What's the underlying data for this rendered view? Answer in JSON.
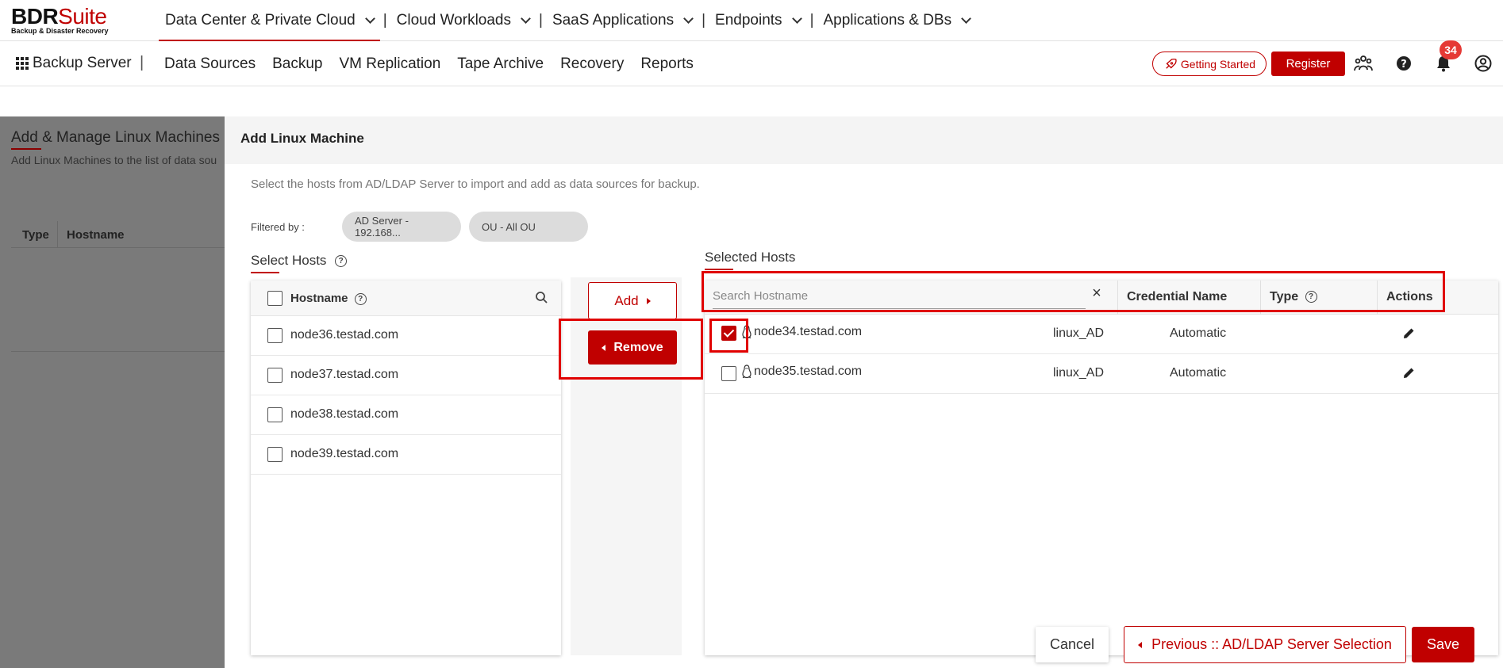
{
  "brand": {
    "name_bold": "BDR",
    "name_light": "Suite",
    "tagline": "Backup & Disaster Recovery"
  },
  "topnav": {
    "items": [
      {
        "label": "Data Center & Private Cloud"
      },
      {
        "label": "Cloud Workloads"
      },
      {
        "label": "SaaS Applications"
      },
      {
        "label": "Endpoints"
      },
      {
        "label": "Applications & DBs"
      }
    ],
    "separator": "|"
  },
  "subnav": {
    "app_name": "Backup Server",
    "separator": "|",
    "items": [
      "Data Sources",
      "Backup",
      "VM Replication",
      "Tape Archive",
      "Recovery",
      "Reports"
    ],
    "getting_started": "Getting Started",
    "register": "Register",
    "notification_count": "34"
  },
  "background_page": {
    "title": "Add & Manage Linux Machines (File",
    "subtitle": "Add Linux Machines to the list of data sou",
    "columns": [
      "Type",
      "Hostname"
    ]
  },
  "modal": {
    "title": "Add Linux Machine",
    "description": "Select the hosts from AD/LDAP Server to import and add as data sources for backup.",
    "filtered_by_label": "Filtered by :",
    "filters": [
      "AD Server - 192.168...",
      "OU - All OU"
    ],
    "select_hosts": {
      "label": "Select Hosts",
      "column": "Hostname",
      "rows": [
        "node36.testad.com",
        "node37.testad.com",
        "node38.testad.com",
        "node39.testad.com"
      ]
    },
    "add_label": "Add",
    "remove_label": "Remove",
    "selected_hosts": {
      "label": "Selected Hosts",
      "search_placeholder": "Search Hostname",
      "columns": {
        "credential": "Credential Name",
        "type": "Type",
        "actions": "Actions"
      },
      "rows": [
        {
          "hostname": "node34.testad.com",
          "credential": "linux_AD",
          "type": "Automatic",
          "checked": true
        },
        {
          "hostname": "node35.testad.com",
          "credential": "linux_AD",
          "type": "Automatic",
          "checked": false
        }
      ]
    },
    "footer": {
      "cancel": "Cancel",
      "previous": "Previous :: AD/LDAP Server Selection",
      "save": "Save"
    }
  },
  "colors": {
    "accent": "#c00000",
    "highlight": "#e00000",
    "overlay": "#7a7a7a",
    "badge": "#e53935"
  },
  "icons": [
    "grid-icon",
    "rocket-icon",
    "users-icon",
    "help-icon",
    "bell-icon",
    "user-icon",
    "search-icon",
    "close-icon",
    "linux-icon",
    "edit-icon",
    "chevron-down-icon"
  ]
}
